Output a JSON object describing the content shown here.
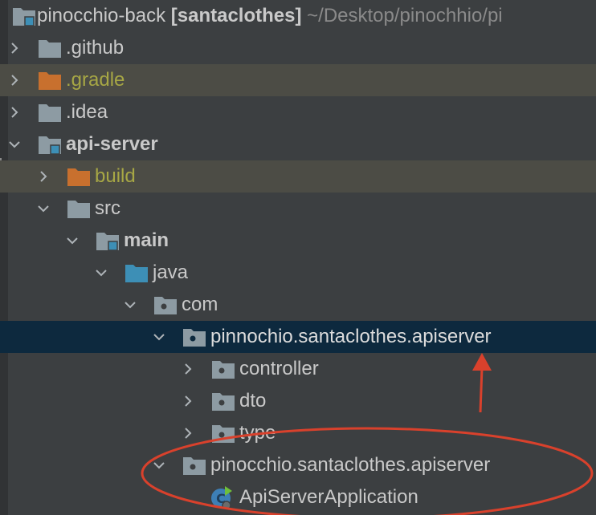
{
  "root": {
    "name": "pinocchio-back",
    "branch": "[santaclothes]",
    "path": "~/Desktop/pinochhio/pi"
  },
  "items": [
    {
      "label": ".github"
    },
    {
      "label": ".gradle"
    },
    {
      "label": ".idea"
    },
    {
      "label": "api-server"
    },
    {
      "label": "build"
    },
    {
      "label": "src"
    },
    {
      "label": "main"
    },
    {
      "label": "java"
    },
    {
      "label": "com"
    },
    {
      "label": "pinnochio.santaclothes.apiserver"
    },
    {
      "label": "controller"
    },
    {
      "label": "dto"
    },
    {
      "label": "type"
    },
    {
      "label": "pinocchio.santaclothes.apiserver"
    },
    {
      "label": "ApiServerApplication"
    }
  ],
  "colors": {
    "background": "#3c3f41",
    "selected_row": "#0d293e",
    "ignored_row": "#4c4c45",
    "ignored_text": "#a7a745",
    "folder_grey": "#8d9ba3",
    "folder_orange": "#c8702e",
    "folder_blue": "#3d8fb6",
    "annotation_red": "#d9412c"
  },
  "icons": {
    "folder": "folder-icon",
    "module": "module-folder-icon",
    "package": "package-folder-icon",
    "source_root": "source-root-folder-icon",
    "excluded": "excluded-folder-icon",
    "spring_boot_class": "spring-boot-class-icon",
    "expanded": "chevron-down-icon",
    "collapsed": "chevron-right-icon"
  }
}
